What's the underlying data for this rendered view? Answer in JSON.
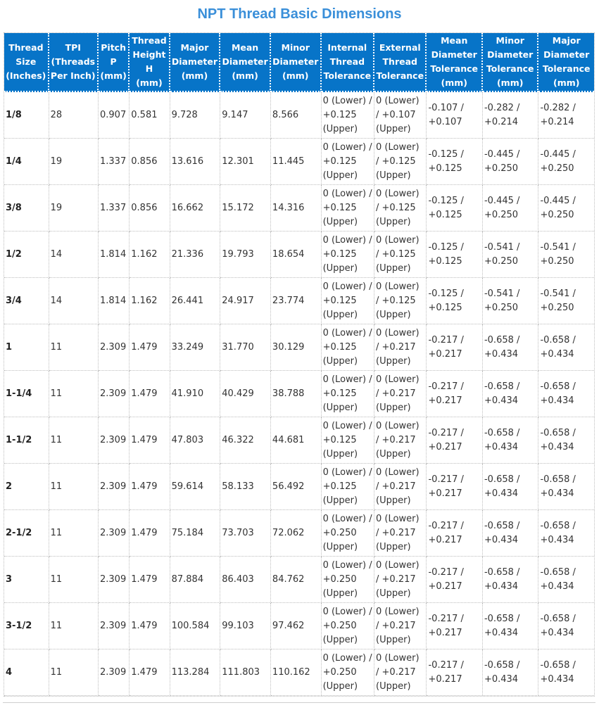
{
  "title": "NPT Thread Basic Dimensions",
  "colors": {
    "header_bg": "#0774c8",
    "title": "#3a8fd9"
  },
  "columns": [
    "Thread Size (Inches)",
    "TPI (Threads Per Inch)",
    "Pitch P (mm)",
    "Thread Height H (mm)",
    "Major Diameter (mm)",
    "Mean Diameter (mm)",
    "Minor Diameter (mm)",
    "Internal Thread Tolerance",
    "External Thread Tolerance",
    "Mean Diameter Tolerance (mm)",
    "Minor Diameter Tolerance (mm)",
    "Major Diameter Tolerance (mm)"
  ],
  "rows": [
    [
      "1/8",
      "28",
      "0.907",
      "0.581",
      "9.728",
      "9.147",
      "8.566",
      "0 (Lower) / +0.125 (Upper)",
      "0 (Lower) / +0.107 (Upper)",
      "-0.107 / +0.107",
      "-0.282 / +0.214",
      "-0.282 / +0.214"
    ],
    [
      "1/4",
      "19",
      "1.337",
      "0.856",
      "13.616",
      "12.301",
      "11.445",
      "0 (Lower) / +0.125 (Upper)",
      "0 (Lower) / +0.125 (Upper)",
      "-0.125 / +0.125",
      "-0.445 / +0.250",
      "-0.445 / +0.250"
    ],
    [
      "3/8",
      "19",
      "1.337",
      "0.856",
      "16.662",
      "15.172",
      "14.316",
      "0 (Lower) / +0.125 (Upper)",
      "0 (Lower) / +0.125 (Upper)",
      "-0.125 / +0.125",
      "-0.445 / +0.250",
      "-0.445 / +0.250"
    ],
    [
      "1/2",
      "14",
      "1.814",
      "1.162",
      "21.336",
      "19.793",
      "18.654",
      "0 (Lower) / +0.125 (Upper)",
      "0 (Lower) / +0.125 (Upper)",
      "-0.125 / +0.125",
      "-0.541 / +0.250",
      "-0.541 / +0.250"
    ],
    [
      "3/4",
      "14",
      "1.814",
      "1.162",
      "26.441",
      "24.917",
      "23.774",
      "0 (Lower) / +0.125 (Upper)",
      "0 (Lower) / +0.125 (Upper)",
      "-0.125 / +0.125",
      "-0.541 / +0.250",
      "-0.541 / +0.250"
    ],
    [
      "1",
      "11",
      "2.309",
      "1.479",
      "33.249",
      "31.770",
      "30.129",
      "0 (Lower) / +0.125 (Upper)",
      "0 (Lower) / +0.217 (Upper)",
      "-0.217 / +0.217",
      "-0.658 / +0.434",
      "-0.658 / +0.434"
    ],
    [
      "1-1/4",
      "11",
      "2.309",
      "1.479",
      "41.910",
      "40.429",
      "38.788",
      "0 (Lower) / +0.125 (Upper)",
      "0 (Lower) / +0.217 (Upper)",
      "-0.217 / +0.217",
      "-0.658 / +0.434",
      "-0.658 / +0.434"
    ],
    [
      "1-1/2",
      "11",
      "2.309",
      "1.479",
      "47.803",
      "46.322",
      "44.681",
      "0 (Lower) / +0.125 (Upper)",
      "0 (Lower) / +0.217 (Upper)",
      "-0.217 / +0.217",
      "-0.658 / +0.434",
      "-0.658 / +0.434"
    ],
    [
      "2",
      "11",
      "2.309",
      "1.479",
      "59.614",
      "58.133",
      "56.492",
      "0 (Lower) / +0.125 (Upper)",
      "0 (Lower) / +0.217 (Upper)",
      "-0.217 / +0.217",
      "-0.658 / +0.434",
      "-0.658 / +0.434"
    ],
    [
      "2-1/2",
      "11",
      "2.309",
      "1.479",
      "75.184",
      "73.703",
      "72.062",
      "0 (Lower) / +0.250 (Upper)",
      "0 (Lower) / +0.217 (Upper)",
      "-0.217 / +0.217",
      "-0.658 / +0.434",
      "-0.658 / +0.434"
    ],
    [
      "3",
      "11",
      "2.309",
      "1.479",
      "87.884",
      "86.403",
      "84.762",
      "0 (Lower) / +0.250 (Upper)",
      "0 (Lower) / +0.217 (Upper)",
      "-0.217 / +0.217",
      "-0.658 / +0.434",
      "-0.658 / +0.434"
    ],
    [
      "3-1/2",
      "11",
      "2.309",
      "1.479",
      "100.584",
      "99.103",
      "97.462",
      "0 (Lower) / +0.250 (Upper)",
      "0 (Lower) / +0.217 (Upper)",
      "-0.217 / +0.217",
      "-0.658 / +0.434",
      "-0.658 / +0.434"
    ],
    [
      "4",
      "11",
      "2.309",
      "1.479",
      "113.284",
      "111.803",
      "110.162",
      "0 (Lower) / +0.250 (Upper)",
      "0 (Lower) / +0.217 (Upper)",
      "-0.217 / +0.217",
      "-0.658 / +0.434",
      "-0.658 / +0.434"
    ]
  ]
}
